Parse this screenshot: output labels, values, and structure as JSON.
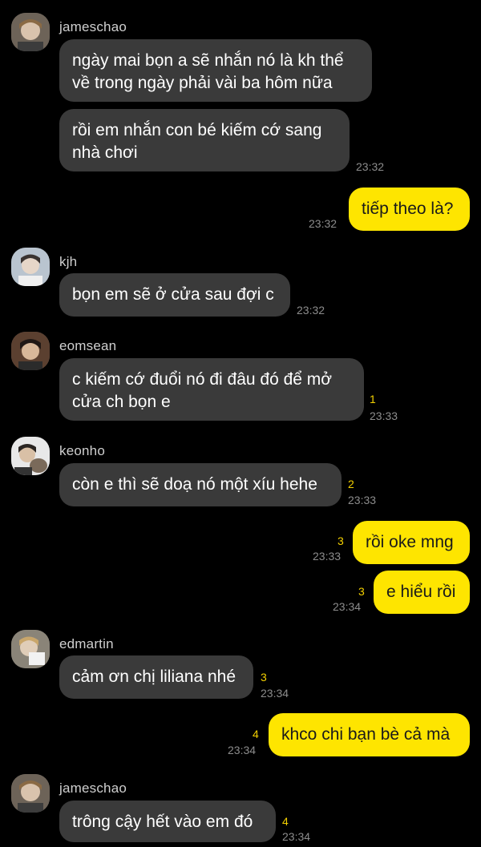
{
  "messages": {
    "m1": {
      "sender": "jameschao",
      "lines": [
        "ngày mai bọn a sẽ nhắn nó là kh thể",
        "về trong ngày phải vài ba hôm nữa"
      ]
    },
    "m2": {
      "lines": [
        "rồi em nhắn con bé kiếm cớ sang",
        "nhà chơi"
      ],
      "time": "23:32"
    },
    "m3": {
      "text": "tiếp theo là?",
      "time": "23:32"
    },
    "m4": {
      "sender": "kjh",
      "text": "bọn em sẽ ở cửa sau đợi c",
      "time": "23:32"
    },
    "m5": {
      "sender": "eomsean",
      "lines": [
        "c kiếm cớ đuổi nó đi đâu đó để mở",
        "cửa ch bọn e"
      ],
      "unread": "1",
      "time": "23:33"
    },
    "m6": {
      "sender": "keonho",
      "text": "còn e thì sẽ doạ nó một xíu hehe",
      "unread": "2",
      "time": "23:33"
    },
    "m7": {
      "text": "rồi oke mng",
      "unread": "3",
      "time": "23:33"
    },
    "m8": {
      "text": "e hiểu rồi",
      "unread": "3",
      "time": "23:34"
    },
    "m9": {
      "sender": "edmartin",
      "text": "cảm ơn chị liliana nhé",
      "unread": "3",
      "time": "23:34"
    },
    "m10": {
      "text": "khco chi bạn bè cả mà",
      "unread": "4",
      "time": "23:34"
    },
    "m11": {
      "sender": "jameschao",
      "text": "trông cậy hết vào em đó",
      "unread": "4",
      "time": "23:34"
    }
  },
  "colors": {
    "background": "#000000",
    "incoming_bubble": "#3a3a3a",
    "outgoing_bubble": "#fee500",
    "unread_count": "#f3d000"
  }
}
